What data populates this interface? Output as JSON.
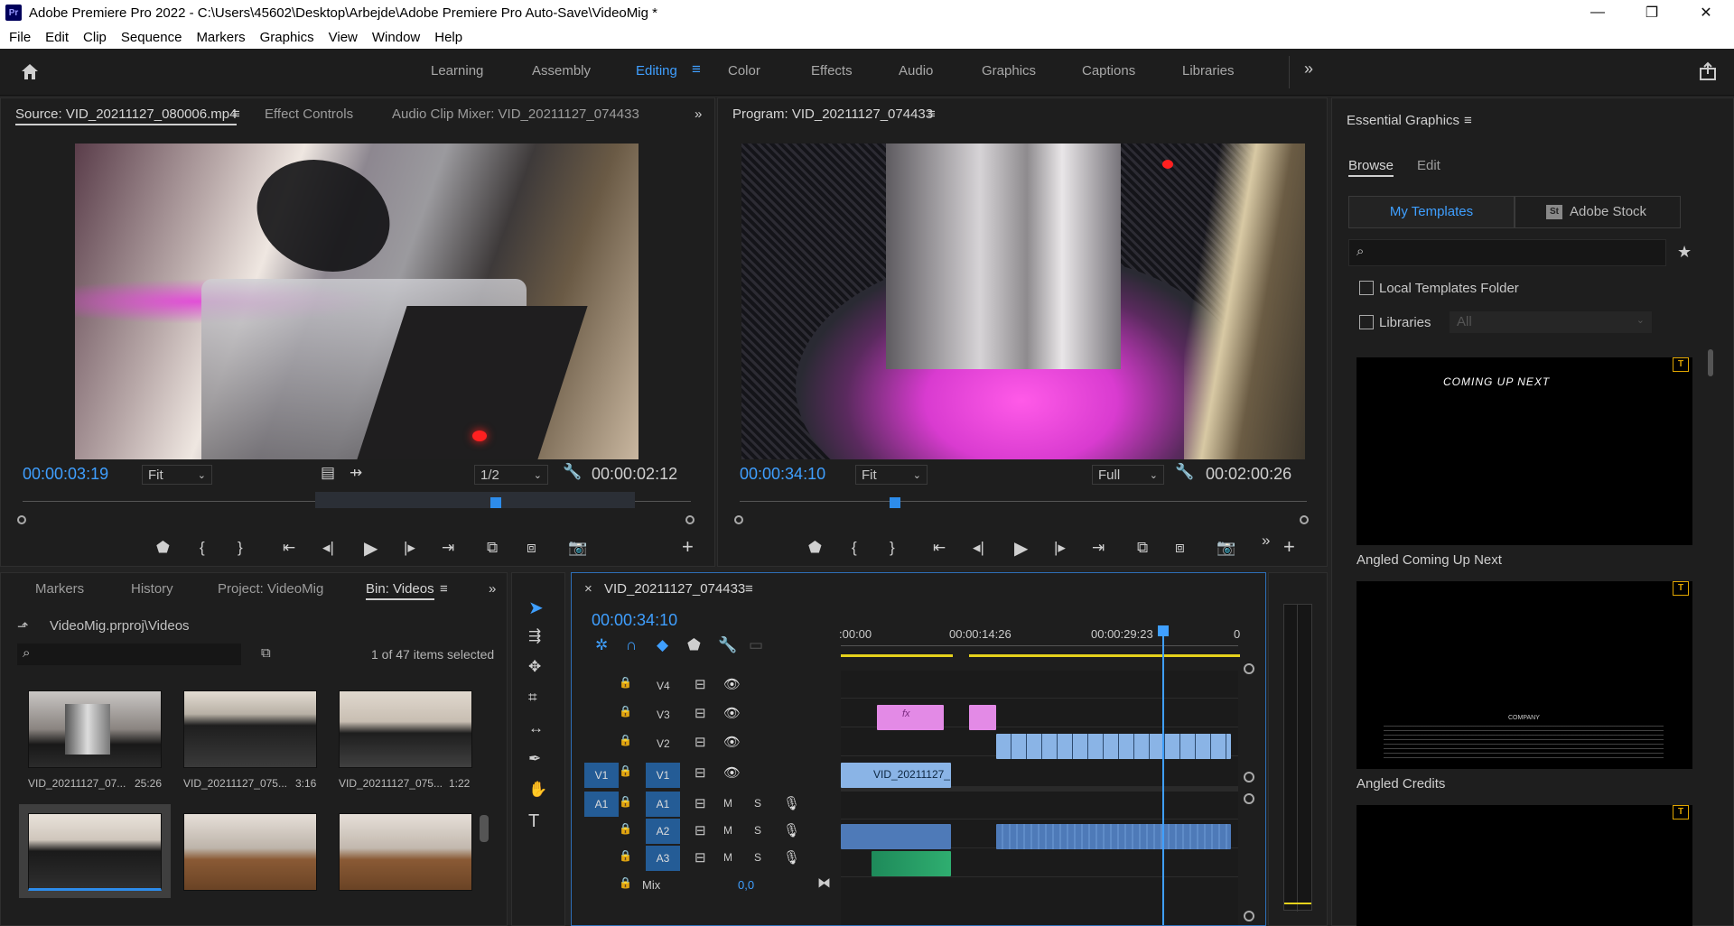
{
  "window": {
    "title": "Adobe Premiere Pro 2022 - C:\\Users\\45602\\Desktop\\Arbejde\\Adobe Premiere Pro Auto-Save\\VideoMig *",
    "icon_label": "Pr",
    "minimize": "—",
    "restore": "❐",
    "close": "✕"
  },
  "menu": [
    "File",
    "Edit",
    "Clip",
    "Sequence",
    "Markers",
    "Graphics",
    "View",
    "Window",
    "Help"
  ],
  "workspaces": {
    "items": [
      "Learning",
      "Assembly",
      "Editing",
      "Color",
      "Effects",
      "Audio",
      "Graphics",
      "Captions",
      "Libraries"
    ],
    "active": "Editing"
  },
  "source": {
    "tabs": [
      "Source: VID_20211127_080006.mp4",
      "Effect Controls",
      "Audio Clip Mixer: VID_20211127_074433"
    ],
    "timecode": "00:00:03:19",
    "fit": "Fit",
    "resolution": "1/2",
    "duration": "00:00:02:12"
  },
  "program": {
    "tab": "Program: VID_20211127_074433",
    "timecode": "00:00:34:10",
    "fit": "Fit",
    "resolution": "Full",
    "duration": "00:02:00:26"
  },
  "essential_graphics": {
    "title": "Essential Graphics",
    "tabs": [
      "Browse",
      "Edit"
    ],
    "source_tabs": [
      "My Templates",
      "Adobe Stock"
    ],
    "stock_badge": "St",
    "search_placeholder": "",
    "local_templates": "Local Templates Folder",
    "libraries": "Libraries",
    "libraries_value": "All",
    "templates": [
      {
        "name": "Angled Coming Up Next",
        "preview_text": "COMING UP NEXT"
      },
      {
        "name": "Angled Credits",
        "preview_text": "COMPANY"
      },
      {
        "name": "",
        "preview_text": ""
      }
    ]
  },
  "project": {
    "tabs": [
      "Markers",
      "History",
      "Project: VideoMig",
      "Bin: Videos"
    ],
    "path": "VideoMig.prproj\\Videos",
    "search_placeholder": "",
    "selection_info": "1 of 47 items selected",
    "items": [
      {
        "name": "VID_20211127_07...",
        "duration": "25:26"
      },
      {
        "name": "VID_20211127_075...",
        "duration": "3:16"
      },
      {
        "name": "VID_20211127_075...",
        "duration": "1:22"
      },
      {
        "name": "",
        "duration": ""
      },
      {
        "name": "",
        "duration": ""
      },
      {
        "name": "",
        "duration": ""
      }
    ]
  },
  "timeline": {
    "close": "×",
    "sequence": "VID_20211127_074433",
    "timecode": "00:00:34:10",
    "ruler": [
      ":00:00",
      "00:00:14:26",
      "00:00:29:23",
      "0"
    ],
    "video_tracks": [
      "V4",
      "V3",
      "V2",
      "V1"
    ],
    "audio_tracks": [
      "A1",
      "A2",
      "A3"
    ],
    "source_patch_video": "V1",
    "source_patch_audio": "A1",
    "mute": "M",
    "solo": "S",
    "mix_label": "Mix",
    "mix_value": "0,0",
    "clip_label": "VID_20211127_",
    "fx_label": "fx"
  },
  "colors": {
    "accent": "#2d8ceb",
    "video_clip": "#8ab4e6",
    "pink_clip": "#e38ae6",
    "audio_clip": "#4e7ab8",
    "green_clip": "#1e8a5a",
    "playhead": "#3f9fff"
  }
}
